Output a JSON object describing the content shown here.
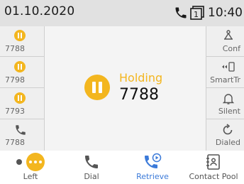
{
  "status_bar": {
    "date": "01.10.2020",
    "time": "10:40",
    "line_indicator": "1",
    "icons": [
      "call-icon",
      "line-key-icon"
    ]
  },
  "left_column": {
    "lines": [
      {
        "number": "7788",
        "icon": "hold-icon",
        "state": "held"
      },
      {
        "number": "7798",
        "icon": "hold-icon",
        "state": "held"
      },
      {
        "number": "7793",
        "icon": "hold-icon",
        "state": "held"
      },
      {
        "number": "7788",
        "icon": "handset-icon",
        "state": "idle"
      }
    ]
  },
  "right_column": {
    "keys": [
      {
        "label": "Conf",
        "icon": "conference-icon"
      },
      {
        "label": "SmartTr",
        "icon": "smart-transfer-icon"
      },
      {
        "label": "Silent",
        "icon": "bell-icon"
      },
      {
        "label": "Dialed",
        "icon": "redial-icon"
      }
    ]
  },
  "call_panel": {
    "status": "Holding",
    "number": "7788"
  },
  "softkeys": [
    {
      "label": "Left",
      "icon": "more-icon",
      "active": false
    },
    {
      "label": "Dial",
      "icon": "handset-icon",
      "active": false
    },
    {
      "label": "Retrieve",
      "icon": "retrieve-icon",
      "active": true
    },
    {
      "label": "Contact Pool",
      "icon": "contact-pool-icon",
      "active": false
    }
  ],
  "colors": {
    "accent": "#f3b61f",
    "active_softkey": "#3b7ad9",
    "status_bar_bg": "#e1e1e1"
  }
}
